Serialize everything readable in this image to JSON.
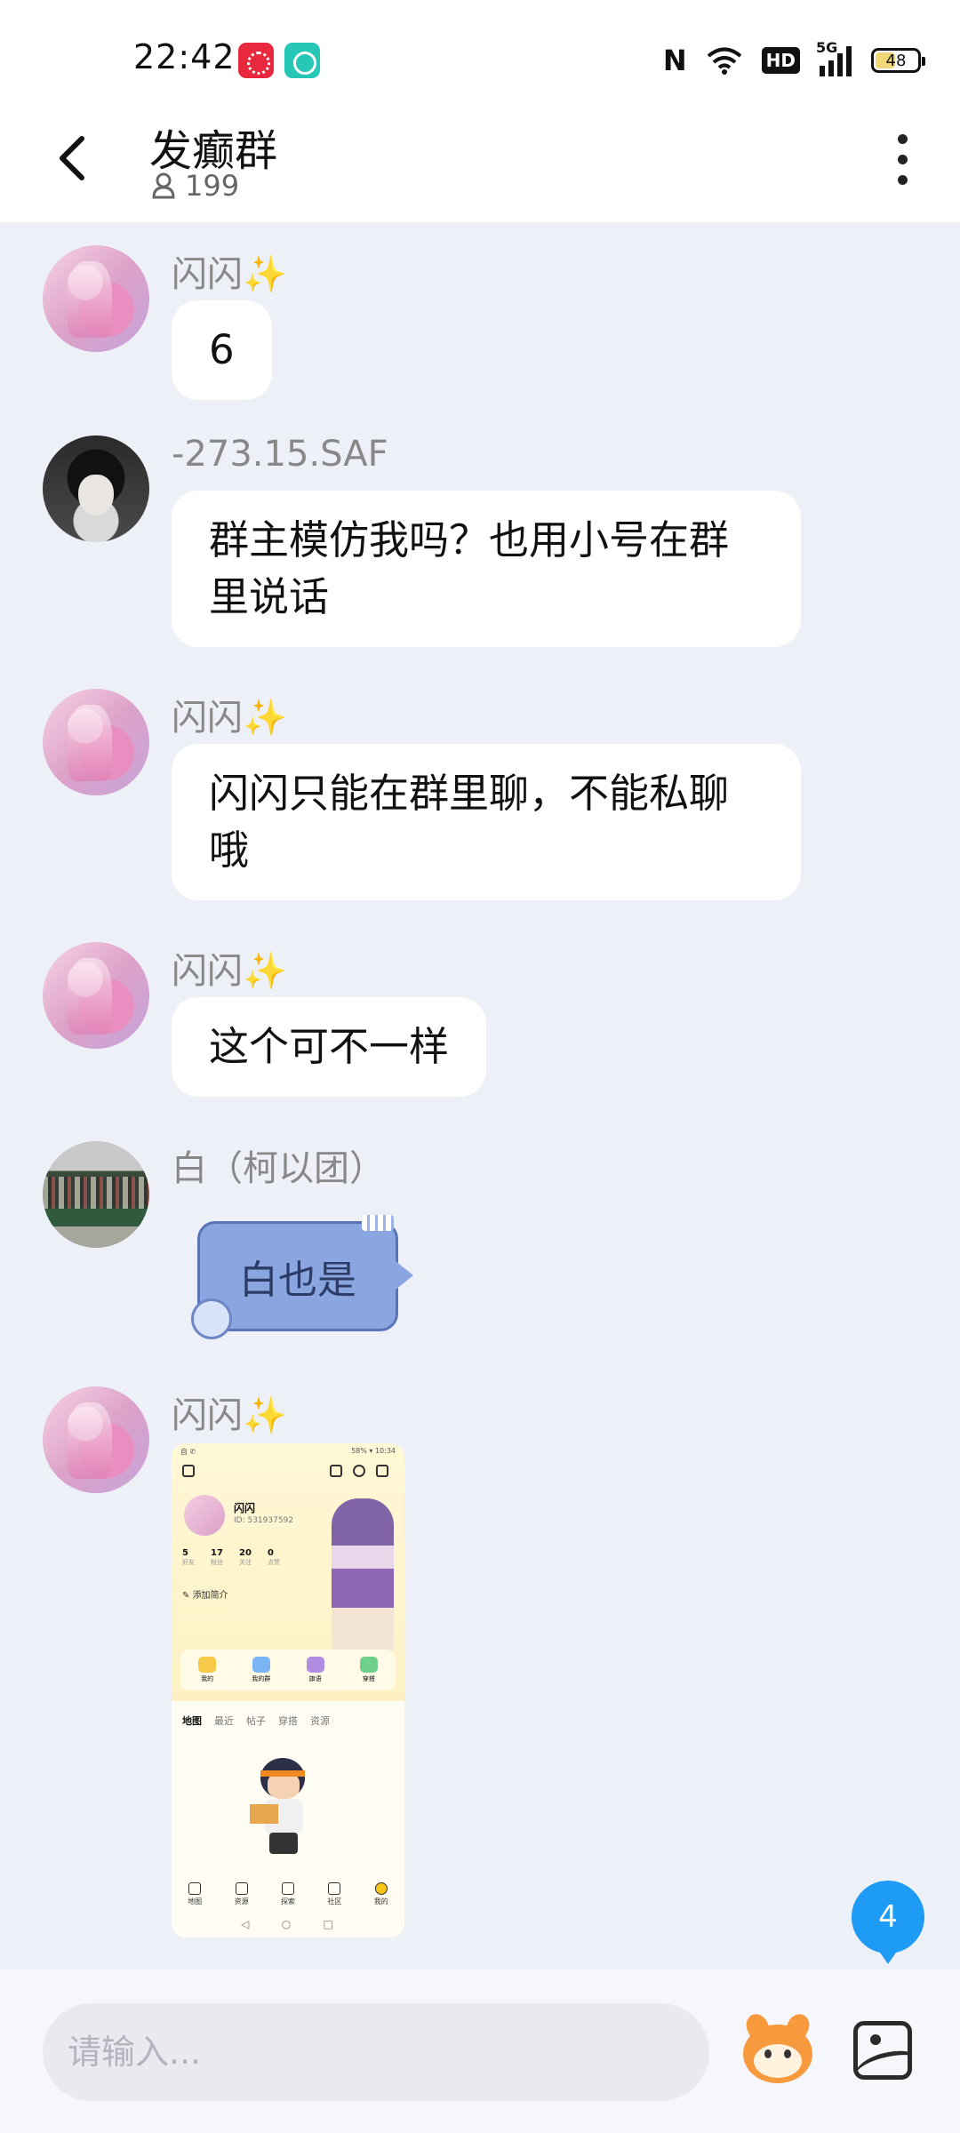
{
  "status_bar": {
    "time": "22:42",
    "hd": "HD",
    "network": "5G",
    "battery": "48",
    "battery_level": 0.48
  },
  "header": {
    "title": "发癫群",
    "member_count": "199",
    "icons": [
      "back-icon",
      "person-icon",
      "more-icon"
    ]
  },
  "messages": [
    {
      "sender": "闪闪✨",
      "text": "6"
    },
    {
      "sender": "-273.15.SAF",
      "line1": "群主模仿我吗？也用小号在群",
      "line2": "里说话"
    },
    {
      "sender": "闪闪✨",
      "line1": "闪闪只能在群里聊，不能私聊",
      "line2": "哦"
    },
    {
      "sender": "闪闪✨",
      "text": "这个可不一样"
    },
    {
      "sender": "白（柯以团）",
      "text": "白也是"
    },
    {
      "sender": "闪闪✨",
      "type": "image"
    }
  ],
  "shared_screenshot": {
    "status_left": "自 ✆",
    "status_right": "58% ▾ 10:34",
    "user_name": "闪闪",
    "user_id": "ID: 531937592",
    "stats": [
      {
        "num": "5",
        "label": "好友"
      },
      {
        "num": "17",
        "label": "粉丝"
      },
      {
        "num": "20",
        "label": "关注"
      },
      {
        "num": "0",
        "label": "点赞"
      }
    ],
    "intro": "添加简介",
    "tiles": [
      "我的",
      "我的群",
      "旗语",
      "穿搭"
    ],
    "tabs": [
      "地图",
      "最近",
      "帖子",
      "穿搭",
      "资源"
    ],
    "bottom_nav": [
      "地图",
      "资源",
      "探索",
      "社区",
      "我的"
    ]
  },
  "unread_count": "4",
  "input": {
    "placeholder": "请输入..."
  },
  "colors": {
    "accent": "#1e9bf4",
    "background": "#eef0f8",
    "bubble": "#ffffff"
  }
}
